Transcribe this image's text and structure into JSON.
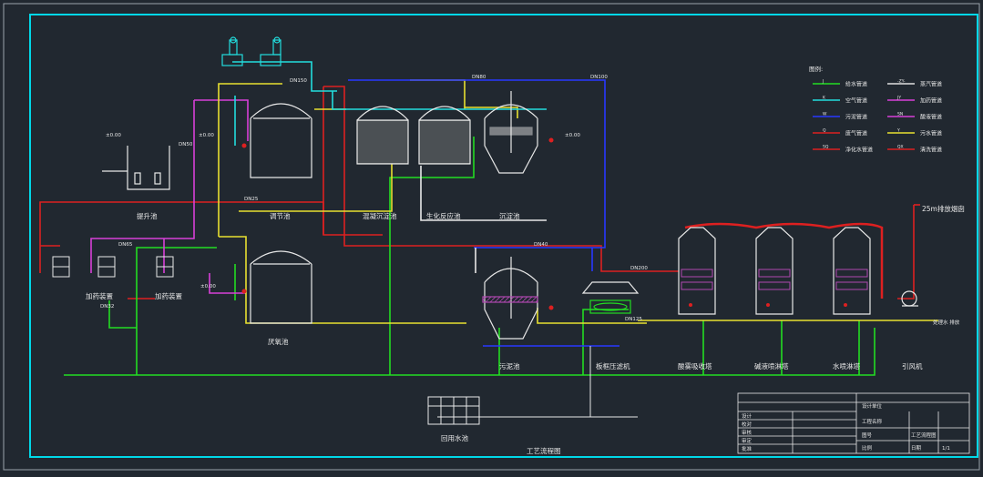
{
  "drawing": {
    "background": "#212830",
    "frame_color": "#00d8e8",
    "legend": {
      "title": "图例:",
      "items": [
        {
          "code": "J",
          "text": "给水管道",
          "color": "#22dd22"
        },
        {
          "code": "-ZY-",
          "text": "蒸汽管道",
          "color": "#e0e0e0"
        },
        {
          "code": "K",
          "text": "空气管道",
          "color": "#22dddd"
        },
        {
          "code": "JY",
          "text": "加药管道",
          "color": "#d840d8"
        },
        {
          "code": "W",
          "text": "污泥管道",
          "color": "#2838ff"
        },
        {
          "code": "SN",
          "text": "酸液管道",
          "color": "#d840d8"
        },
        {
          "code": "Q",
          "text": "废气管道",
          "color": "#dd2020"
        },
        {
          "code": "Y",
          "text": "污水管道",
          "color": "#e8e030"
        },
        {
          "code": "SQ",
          "text": "净化水管道",
          "color": "#dd2020"
        },
        {
          "code": "QX",
          "text": "清洗管道",
          "color": "#dd2020"
        }
      ]
    },
    "unit_labels": {
      "pump_pit": "提升池",
      "reg_tank": "调节池",
      "coag": "混凝沉淀池",
      "biochem": "生化反应池",
      "sed": "沉淀池",
      "anaerobic": "厌氧池",
      "sludge": "污泥池",
      "sludge_press": "板框压滤机",
      "acid_tower": "酸雾吸收塔",
      "water_tower": "水喷淋塔",
      "alkali_tower": "碱液喷淋塔",
      "fan": "引风机",
      "dosing1": "加药装置",
      "dosing2": "加药装置",
      "reuse": "回用水池",
      "chimney": "25m排放烟囱",
      "bottom_title": "工艺流程图"
    },
    "pipe_notes": {
      "p1": "DN150",
      "p2": "DN80",
      "p3": "DN100",
      "p4": "DN50",
      "p5": "DN65",
      "p6": "DN25",
      "p7": "DN40",
      "p8": "DN32",
      "p9": "DN125",
      "p10": "DN200",
      "elev1": "±0.00",
      "elev2": "±0.00",
      "elev3": "±0.00",
      "elev4": "±0.00",
      "outlet": "处理水 排放"
    },
    "title_block": {
      "design_unit": "设计单位",
      "project": "工程名称",
      "drawing_name": "工艺流程图",
      "drawing_no": "图号",
      "scale": "比例",
      "date": "日期",
      "rows": [
        "设计",
        "校对",
        "审核",
        "审定",
        "批准"
      ],
      "sheet": "1/1"
    }
  }
}
